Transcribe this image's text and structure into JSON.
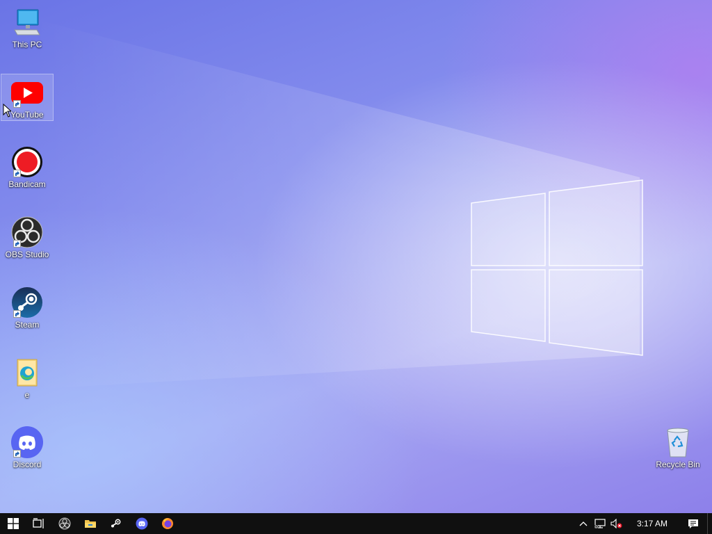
{
  "desktop": {
    "icons": [
      {
        "label": "This PC",
        "icon": "computer-icon"
      },
      {
        "label": "YouTube",
        "icon": "youtube-icon",
        "shortcut": true,
        "selected": true
      },
      {
        "label": "Bandicam",
        "icon": "bandicam-icon",
        "shortcut": true
      },
      {
        "label": "OBS Studio",
        "icon": "obs-icon",
        "shortcut": true
      },
      {
        "label": "Steam",
        "icon": "steam-icon",
        "shortcut": true
      },
      {
        "label": "e",
        "icon": "edge-folder-icon"
      },
      {
        "label": "Discord",
        "icon": "discord-icon",
        "shortcut": true
      },
      {
        "label": "Recycle Bin",
        "icon": "recycle-bin-icon"
      }
    ]
  },
  "taskbar": {
    "pinned": [
      "start-icon",
      "task-view-icon",
      "obs-icon",
      "file-explorer-icon",
      "steam-icon",
      "discord-icon",
      "firefox-icon"
    ],
    "tray": {
      "icons": [
        "chevron-up-icon",
        "network-icon",
        "volume-muted-icon"
      ],
      "time": "3:17 AM",
      "notification_icon": "action-center-icon"
    }
  },
  "colors": {
    "taskbar": "#101010",
    "youtube_red": "#ff0000",
    "discord_blurple": "#5865f2",
    "steam_blue": "#1b3a63"
  }
}
